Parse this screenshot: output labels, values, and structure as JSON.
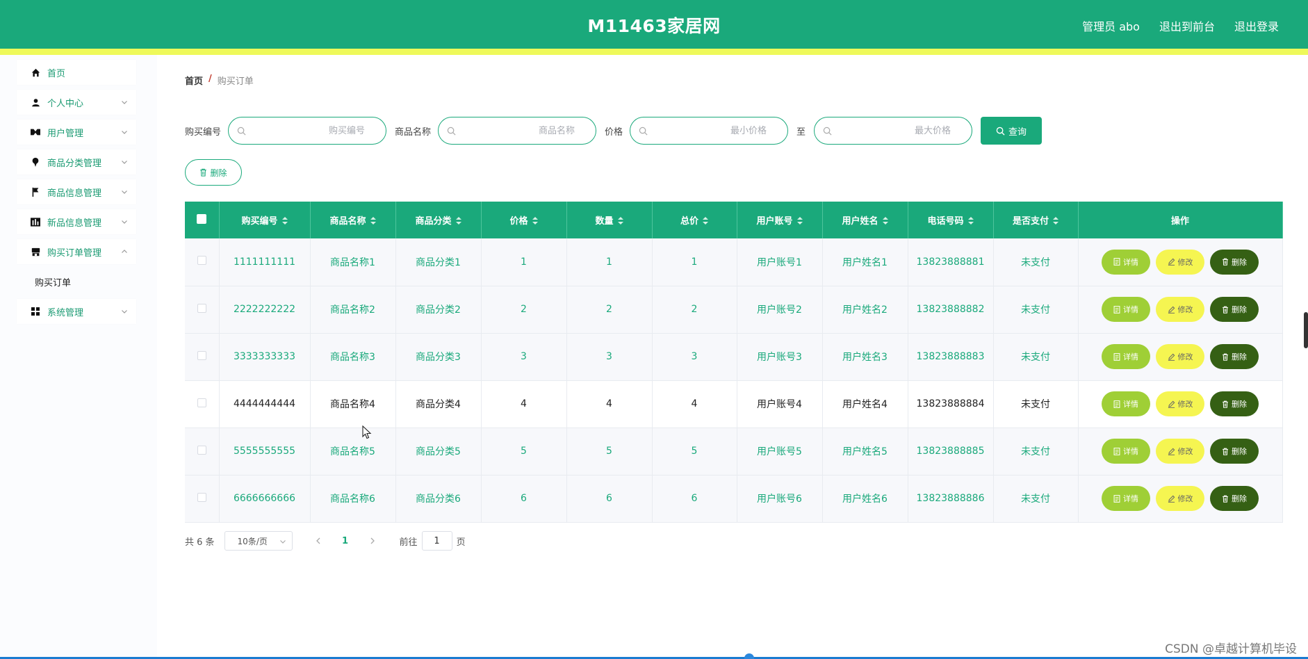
{
  "header": {
    "title": "M11463家居网",
    "admin_label": "管理员 abo",
    "front_link": "退出到前台",
    "logout_link": "退出登录"
  },
  "sidebar": {
    "items": [
      {
        "label": "首页",
        "icon": "home-icon"
      },
      {
        "label": "个人中心",
        "icon": "user-icon"
      },
      {
        "label": "用户管理",
        "icon": "users-icon"
      },
      {
        "label": "商品分类管理",
        "icon": "pin-icon"
      },
      {
        "label": "商品信息管理",
        "icon": "flag-icon"
      },
      {
        "label": "新品信息管理",
        "icon": "chart-icon"
      },
      {
        "label": "购买订单管理",
        "icon": "shop-icon"
      },
      {
        "label": "购买订单",
        "sub": true
      },
      {
        "label": "系统管理",
        "icon": "grid-icon"
      }
    ]
  },
  "breadcrumb": {
    "home": "首页",
    "separator": "/",
    "current": "购买订单"
  },
  "search": {
    "order_no_label": "购买编号",
    "order_no_placeholder": "购买编号",
    "product_name_label": "商品名称",
    "product_name_placeholder": "商品名称",
    "price_label": "价格",
    "min_price_placeholder": "最小价格",
    "to_label": "至",
    "max_price_placeholder": "最大价格",
    "query_button": "查询"
  },
  "bulk_delete_button": "删除",
  "table": {
    "columns": [
      "购买编号",
      "商品名称",
      "商品分类",
      "价格",
      "数量",
      "总价",
      "用户账号",
      "用户姓名",
      "电话号码",
      "是否支付",
      "操作"
    ],
    "rows": [
      [
        "1111111111",
        "商品名称1",
        "商品分类1",
        "1",
        "1",
        "1",
        "用户账号1",
        "用户姓名1",
        "13823888881",
        "未支付"
      ],
      [
        "2222222222",
        "商品名称2",
        "商品分类2",
        "2",
        "2",
        "2",
        "用户账号2",
        "用户姓名2",
        "13823888882",
        "未支付"
      ],
      [
        "3333333333",
        "商品名称3",
        "商品分类3",
        "3",
        "3",
        "3",
        "用户账号3",
        "用户姓名3",
        "13823888883",
        "未支付"
      ],
      [
        "4444444444",
        "商品名称4",
        "商品分类4",
        "4",
        "4",
        "4",
        "用户账号4",
        "用户姓名4",
        "13823888884",
        "未支付"
      ],
      [
        "5555555555",
        "商品名称5",
        "商品分类5",
        "5",
        "5",
        "5",
        "用户账号5",
        "用户姓名5",
        "13823888885",
        "未支付"
      ],
      [
        "6666666666",
        "商品名称6",
        "商品分类6",
        "6",
        "6",
        "6",
        "用户账号6",
        "用户姓名6",
        "13823888886",
        "未支付"
      ]
    ],
    "actions": {
      "detail": "详情",
      "edit": "修改",
      "delete": "删除"
    }
  },
  "pagination": {
    "total": "共 6 条",
    "page_size": "10条/页",
    "current_page": "1",
    "goto_prefix": "前往",
    "goto_value": "1",
    "goto_suffix": "页"
  },
  "watermark": "CSDN @卓越计算机毕设",
  "colors": {
    "primary": "#1aa97b",
    "stripe": "#eef95a",
    "detail_button": "#9fcf36",
    "edit_button": "#f5f551",
    "delete_button": "#356014"
  }
}
